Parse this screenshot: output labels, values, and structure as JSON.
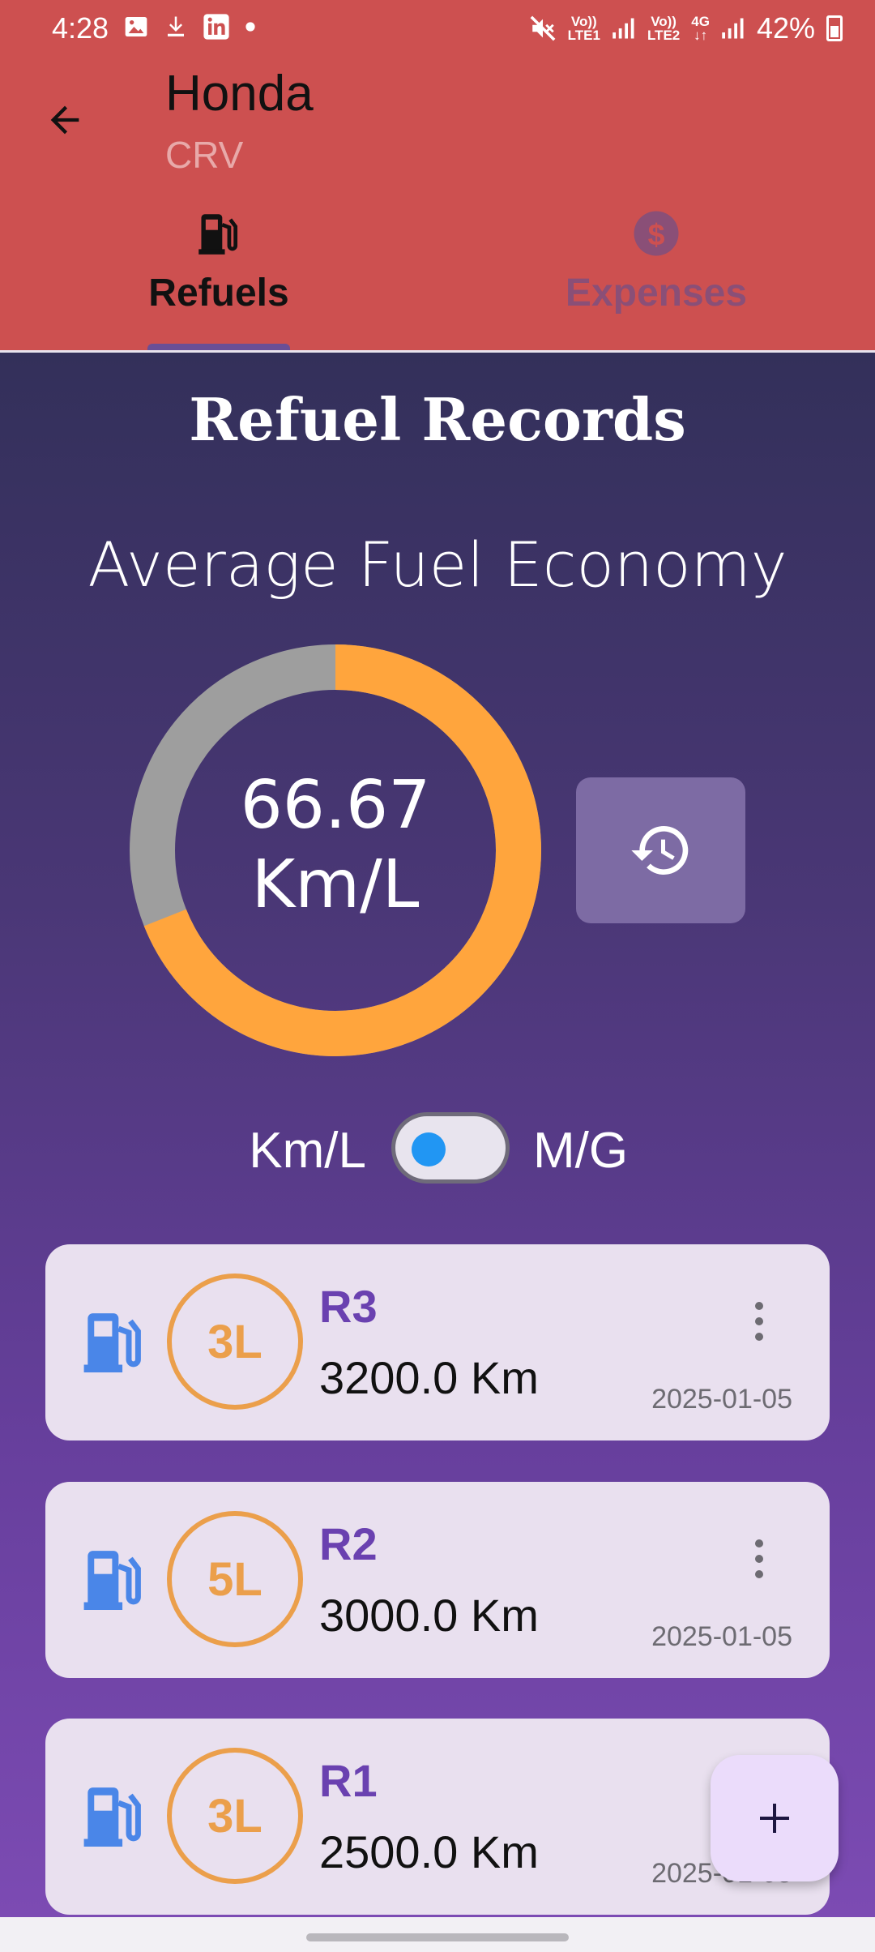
{
  "status_bar": {
    "time": "4:28",
    "left_icons": [
      "image-icon",
      "download-icon",
      "linkedin-icon",
      "dot-icon"
    ],
    "sim1": [
      "Vo))",
      "LTE1"
    ],
    "sim2": [
      "Vo))",
      "LTE2"
    ],
    "network": "4G",
    "battery": "42%"
  },
  "header": {
    "title": "Honda",
    "subtitle": "CRV",
    "background": "#cd5050"
  },
  "tabs": [
    {
      "label": "Refuels",
      "icon": "fuel-pump-icon",
      "selected": true
    },
    {
      "label": "Expenses",
      "icon": "dollar-icon",
      "selected": false
    }
  ],
  "main": {
    "heading": "Refuel Records",
    "avg_label": "Average Fuel Economy",
    "economy_value": "66.67",
    "economy_unit": "Km/L",
    "gauge_fraction": 0.69,
    "gauge_colors": {
      "fill": "#ffa53d",
      "rest": "#9e9e9e"
    },
    "history_icon": "history-icon",
    "unit_toggle": {
      "left": "Km/L",
      "right": "M/G",
      "on": false
    }
  },
  "records": [
    {
      "name": "R3",
      "liters": "3L",
      "odometer": "3200.0 Km",
      "date": "2025-01-05"
    },
    {
      "name": "R2",
      "liters": "5L",
      "odometer": "3000.0 Km",
      "date": "2025-01-05"
    },
    {
      "name": "R1",
      "liters": "3L",
      "odometer": "2500.0 Km",
      "date": "2025-01-05"
    }
  ],
  "fab": {
    "icon": "plus-icon"
  }
}
